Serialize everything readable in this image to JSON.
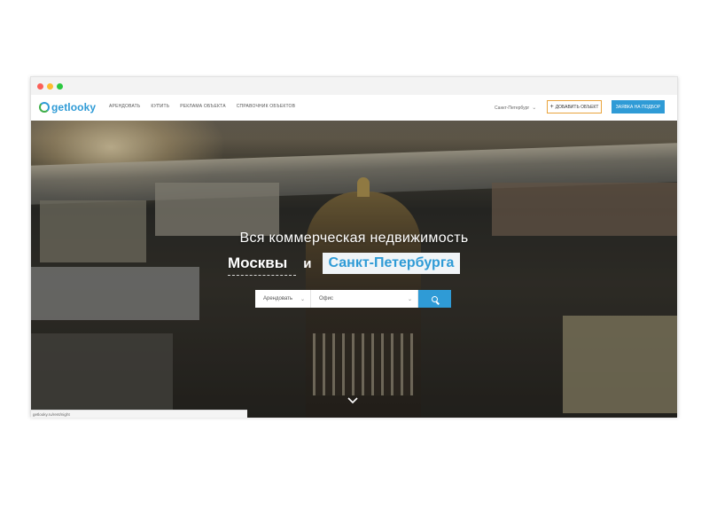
{
  "browser": {
    "status_url": "getlooky.ru/rent/night"
  },
  "navbar": {
    "logo_text": "getlooky",
    "links": [
      "Арендовать",
      "Купить",
      "Реклама объекта",
      "Справочник объектов"
    ],
    "city_select": "Санкт-Петербург",
    "add_object_label": "Добавить объект",
    "request_label": "Заявка на подбор"
  },
  "hero": {
    "subtitle": "Вся коммерческая недвижимость",
    "city_a": "Москвы",
    "conjunction": "и",
    "city_b": "Санкт-Петербурга"
  },
  "search": {
    "deal_type": "Арендовать",
    "object_type": "Офис"
  },
  "colors": {
    "brand_blue": "#2f9bd6",
    "brand_green": "#3fae49",
    "add_button_border": "#e9a43d"
  }
}
